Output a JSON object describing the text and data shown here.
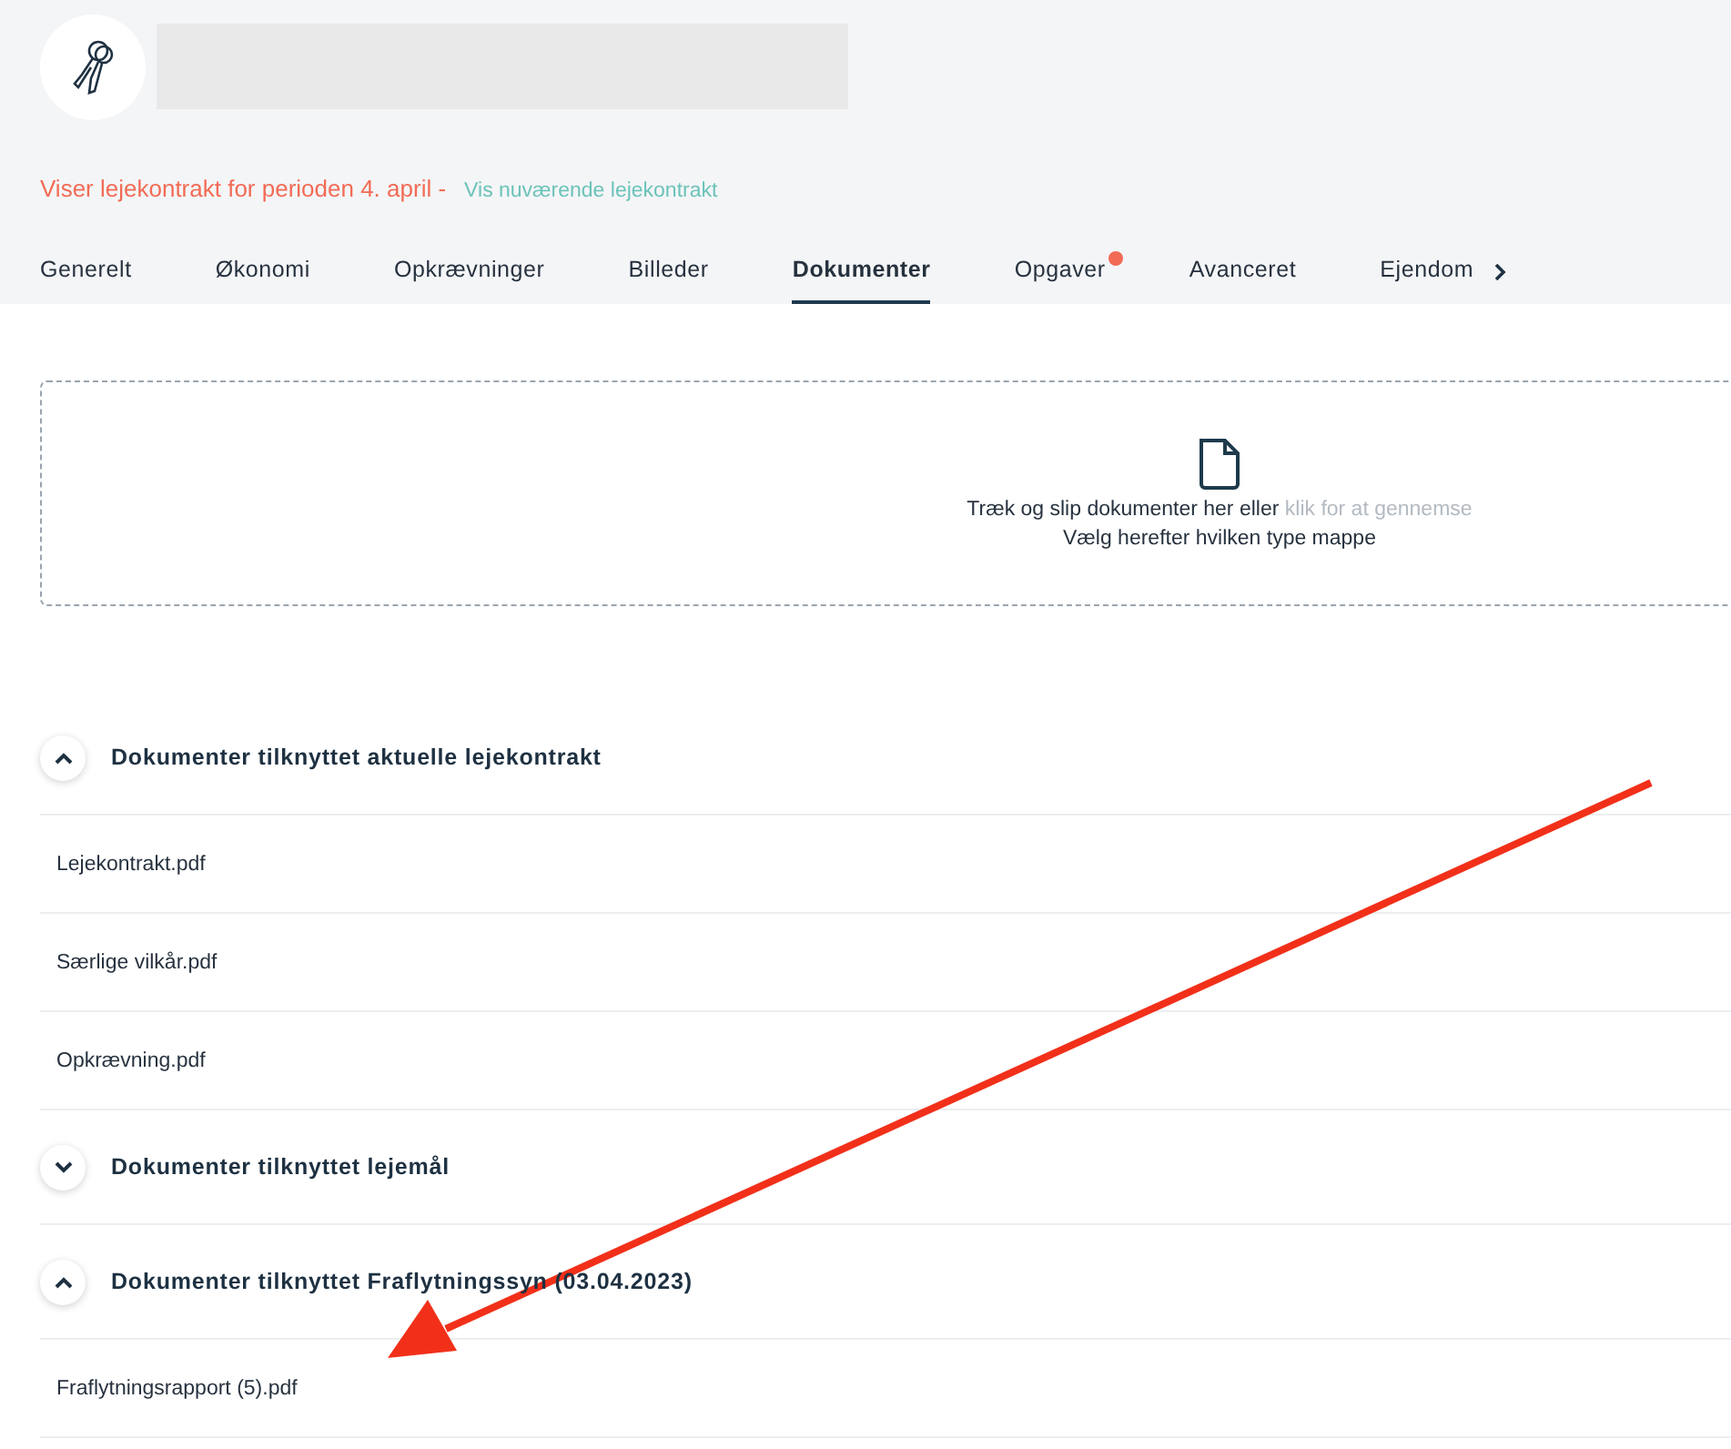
{
  "notice": {
    "text": "Viser lejekontrakt for perioden 4. april -",
    "link": "Vis nuværende lejekontrakt"
  },
  "tabs": [
    {
      "label": "Generelt",
      "selected": false,
      "dot": false
    },
    {
      "label": "Økonomi",
      "selected": false,
      "dot": false
    },
    {
      "label": "Opkrævninger",
      "selected": false,
      "dot": false
    },
    {
      "label": "Billeder",
      "selected": false,
      "dot": false
    },
    {
      "label": "Dokumenter",
      "selected": true,
      "dot": false
    },
    {
      "label": "Opgaver",
      "selected": false,
      "dot": true
    },
    {
      "label": "Avanceret",
      "selected": false,
      "dot": false
    },
    {
      "label": "Ejendom",
      "selected": false,
      "dot": false
    }
  ],
  "dropzone": {
    "text": "Træk og slip dokumenter her eller",
    "link": "klik for at gennemse",
    "hint": "Vælg herefter hvilken type mappe"
  },
  "sections": [
    {
      "title": "Dokumenter tilknyttet aktuelle lejekontrakt",
      "expanded": true,
      "files": [
        "Lejekontrakt.pdf",
        "Særlige vilkår.pdf",
        "Opkrævning.pdf"
      ]
    },
    {
      "title": "Dokumenter tilknyttet lejemål",
      "expanded": false
    },
    {
      "title": "Dokumenter tilknyttet Fraflytningssyn (03.04.2023)",
      "expanded": true,
      "files": [
        "Fraflytningsrapport (5).pdf"
      ]
    }
  ]
}
